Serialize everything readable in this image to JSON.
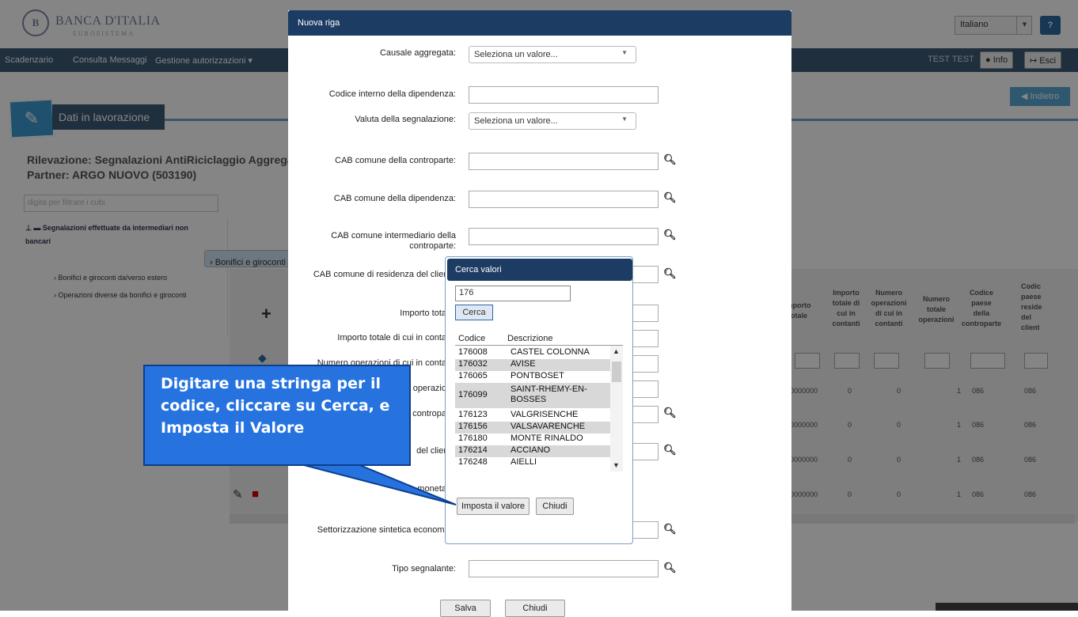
{
  "header": {
    "logo_monogram": "B",
    "logo_name": "BANCA D'ITALIA",
    "logo_sub": "EUROSISTEMA",
    "language": "Italiano",
    "help_icon": "question-circle-icon"
  },
  "nav": {
    "items": [
      "Scadenzario",
      "Consulta Messaggi",
      "Gestione autorizzazioni ▾"
    ],
    "user": "TEST TEST",
    "info_label": "Info",
    "esci_label": "Esci"
  },
  "section": {
    "title": "Dati in lavorazione",
    "back_label": "Indietro",
    "rilevazione": "Rilevazione: Segnalazioni AntiRiciclaggio Aggregate",
    "partner": "Partner: ARGO NUOVO (503190)",
    "filter_placeholder": "digita per filtrare i cubi"
  },
  "tree": {
    "root": "Segnalazioni effettuate da intermediari non bancari",
    "items": [
      "Bonifici e giroconti da/verso Italia",
      "Bonifici e giroconti da/verso estero",
      "Operazioni diverse da bonifici e giroconti"
    ]
  },
  "grid": {
    "headers": [
      "nporto\ntotale",
      "Importo\ntotale di\ncui in\ncontanti",
      "Numero\noperazioni\ndi cui in\ncontanti",
      "Numero\ntotale\noperazioni",
      "Codice\npaese\ndella\ncontroparte",
      "Codic\npaese\nreside\ndel\nclient"
    ],
    "rows": [
      [
        "0000000",
        "0",
        "0",
        "1",
        "086",
        "086"
      ],
      [
        "0000000",
        "0",
        "0",
        "1",
        "086",
        "086"
      ],
      [
        "0000000",
        "0",
        "0",
        "1",
        "086",
        "086"
      ],
      [
        "0000000",
        "0",
        "0",
        "1",
        "086",
        "086"
      ]
    ]
  },
  "dialog": {
    "title": "Nuova riga",
    "fields": {
      "causale": "Causale aggregata:",
      "codice_interno": "Codice interno della dipendenza:",
      "valuta": "Valuta della segnalazione:",
      "cab_controparte": "CAB comune della controparte:",
      "cab_dipendenza": "CAB comune della dipendenza:",
      "cab_intermediario": "CAB comune intermediario della controparte:",
      "cab_residenza": "CAB comune di residenza del clier",
      "importo_totale": "Importo tota",
      "importo_contanti": "Importo totale di cui in conta",
      "numero_contanti": "Numero operazioni di cui in conta",
      "numero_totale": "e operazio",
      "paese_controparte": "contropa",
      "paese_cliente": "del clier",
      "moneta": "moneta",
      "settorizzazione": "Settorizzazione sintetica economi",
      "tipo_segnalante": "Tipo segnalante:"
    },
    "select_placeholder": "Seleziona un valore...",
    "save_label": "Salva",
    "close_label": "Chiudi"
  },
  "search_popup": {
    "title": "Cerca valori",
    "query": "176",
    "search_label": "Cerca",
    "col_code": "Codice",
    "col_desc": "Descrizione",
    "rows": [
      {
        "code": "176008",
        "desc": "CASTEL COLONNA"
      },
      {
        "code": "176032",
        "desc": "AVISE"
      },
      {
        "code": "176065",
        "desc": "PONTBOSET"
      },
      {
        "code": "176099",
        "desc": "SAINT-RHEMY-EN-BOSSES"
      },
      {
        "code": "176123",
        "desc": "VALGRISENCHE"
      },
      {
        "code": "176156",
        "desc": "VALSAVARENCHE"
      },
      {
        "code": "176180",
        "desc": "MONTE RINALDO"
      },
      {
        "code": "176214",
        "desc": "ACCIANO"
      },
      {
        "code": "176248",
        "desc": "AIELLI"
      }
    ],
    "set_label": "Imposta il valore",
    "close_label": "Chiudi"
  },
  "callout": {
    "text": "Digitare una stringa per il codice, cliccare su Cerca, e Imposta il Valore"
  },
  "colors": {
    "navy": "#1d3c63",
    "nav": "#3d5a78",
    "callout": "#2673e0"
  }
}
